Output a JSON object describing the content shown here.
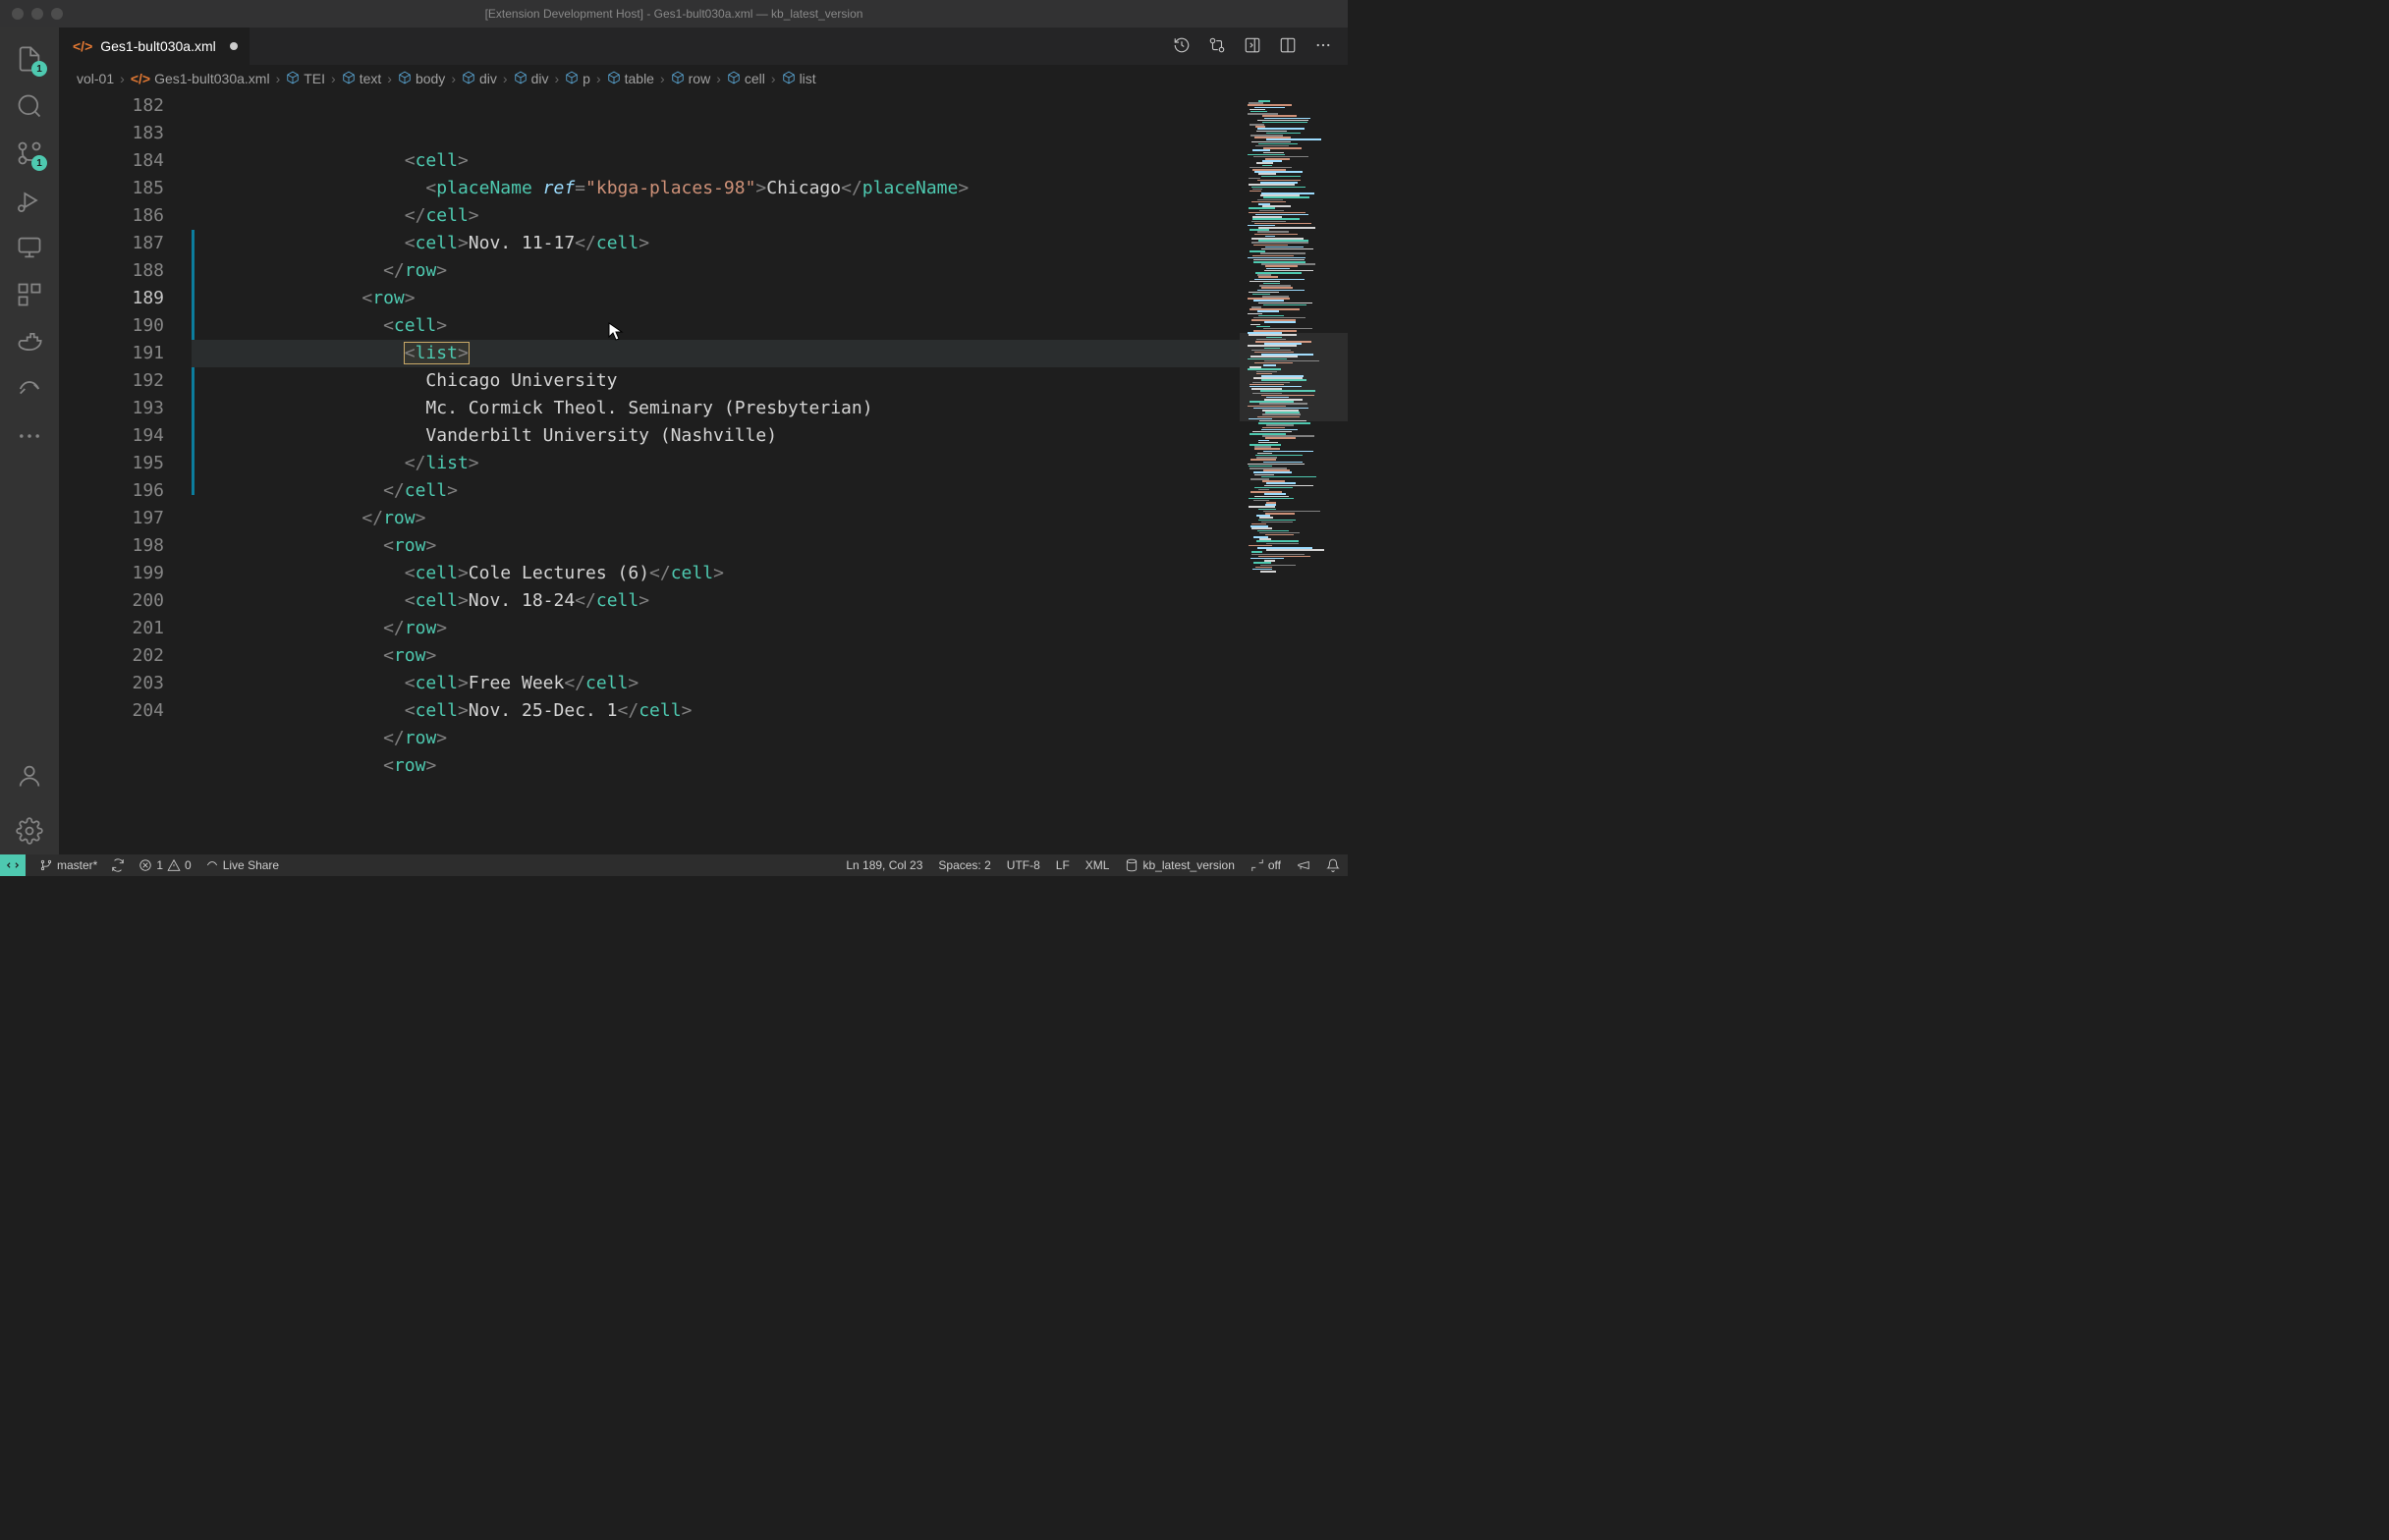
{
  "window": {
    "title": "[Extension Development Host] - Ges1-bult030a.xml — kb_latest_version"
  },
  "activitybar": {
    "explorer_badge": "1",
    "scm_badge": "1"
  },
  "tab": {
    "icon": "</>",
    "label": "Ges1-bult030a.xml"
  },
  "breadcrumbs": [
    {
      "label": "vol-01",
      "icon": ""
    },
    {
      "label": "Ges1-bult030a.xml",
      "icon": "orange"
    },
    {
      "label": "TEI",
      "icon": "cube"
    },
    {
      "label": "text",
      "icon": "cube"
    },
    {
      "label": "body",
      "icon": "cube"
    },
    {
      "label": "div",
      "icon": "cube"
    },
    {
      "label": "div",
      "icon": "cube"
    },
    {
      "label": "p",
      "icon": "cube"
    },
    {
      "label": "table",
      "icon": "cube"
    },
    {
      "label": "row",
      "icon": "cube"
    },
    {
      "label": "cell",
      "icon": "cube"
    },
    {
      "label": "list",
      "icon": "cube"
    }
  ],
  "code": {
    "start": 182,
    "current": 189,
    "lines": [
      {
        "indent": 20,
        "tokens": [
          [
            "tag",
            "<"
          ],
          [
            "tagname",
            "cell"
          ],
          [
            "tag",
            ">"
          ]
        ]
      },
      {
        "indent": 22,
        "tokens": [
          [
            "tag",
            "<"
          ],
          [
            "tagname",
            "placeName"
          ],
          [
            "text",
            " "
          ],
          [
            "attr",
            "ref"
          ],
          [
            "tag",
            "="
          ],
          [
            "string",
            "\"kbga-places-98\""
          ],
          [
            "tag",
            ">"
          ],
          [
            "text",
            "Chicago"
          ],
          [
            "tag",
            "</"
          ],
          [
            "tagname",
            "placeName"
          ],
          [
            "tag",
            ">"
          ]
        ]
      },
      {
        "indent": 20,
        "tokens": [
          [
            "tag",
            "</"
          ],
          [
            "tagname",
            "cell"
          ],
          [
            "tag",
            ">"
          ]
        ]
      },
      {
        "indent": 20,
        "tokens": [
          [
            "tag",
            "<"
          ],
          [
            "tagname",
            "cell"
          ],
          [
            "tag",
            ">"
          ],
          [
            "text",
            "Nov. 11-17"
          ],
          [
            "tag",
            "</"
          ],
          [
            "tagname",
            "cell"
          ],
          [
            "tag",
            ">"
          ]
        ]
      },
      {
        "indent": 18,
        "tokens": [
          [
            "tag",
            "</"
          ],
          [
            "tagname",
            "row"
          ],
          [
            "tag",
            ">"
          ]
        ]
      },
      {
        "indent": 16,
        "tokens": [
          [
            "tag",
            "<"
          ],
          [
            "tagname",
            "row"
          ],
          [
            "tag",
            ">"
          ]
        ]
      },
      {
        "indent": 18,
        "tokens": [
          [
            "tag",
            "<"
          ],
          [
            "tagname",
            "cell"
          ],
          [
            "tag",
            ">"
          ]
        ]
      },
      {
        "indent": 20,
        "tokens": [
          [
            "tag",
            "<"
          ],
          [
            "tagname",
            "list"
          ],
          [
            "tag",
            ">"
          ]
        ],
        "highlight": true
      },
      {
        "indent": 22,
        "tokens": [
          [
            "text",
            "Chicago University"
          ]
        ]
      },
      {
        "indent": 22,
        "tokens": [
          [
            "text",
            "Mc. Cormick Theol. Seminary (Presbyterian)"
          ]
        ]
      },
      {
        "indent": 22,
        "tokens": [
          [
            "text",
            "Vanderbilt University (Nashville)"
          ]
        ]
      },
      {
        "indent": 20,
        "tokens": [
          [
            "tag",
            "</"
          ],
          [
            "tagname",
            "list"
          ],
          [
            "tag",
            ">"
          ]
        ]
      },
      {
        "indent": 18,
        "tokens": [
          [
            "tag",
            "</"
          ],
          [
            "tagname",
            "cell"
          ],
          [
            "tag",
            ">"
          ]
        ]
      },
      {
        "indent": 16,
        "tokens": [
          [
            "tag",
            "</"
          ],
          [
            "tagname",
            "row"
          ],
          [
            "tag",
            ">"
          ]
        ]
      },
      {
        "indent": 18,
        "tokens": [
          [
            "tag",
            "<"
          ],
          [
            "tagname",
            "row"
          ],
          [
            "tag",
            ">"
          ]
        ]
      },
      {
        "indent": 20,
        "tokens": [
          [
            "tag",
            "<"
          ],
          [
            "tagname",
            "cell"
          ],
          [
            "tag",
            ">"
          ],
          [
            "text",
            "Cole Lectures (6)"
          ],
          [
            "tag",
            "</"
          ],
          [
            "tagname",
            "cell"
          ],
          [
            "tag",
            ">"
          ]
        ]
      },
      {
        "indent": 20,
        "tokens": [
          [
            "tag",
            "<"
          ],
          [
            "tagname",
            "cell"
          ],
          [
            "tag",
            ">"
          ],
          [
            "text",
            "Nov. 18-24"
          ],
          [
            "tag",
            "</"
          ],
          [
            "tagname",
            "cell"
          ],
          [
            "tag",
            ">"
          ]
        ]
      },
      {
        "indent": 18,
        "tokens": [
          [
            "tag",
            "</"
          ],
          [
            "tagname",
            "row"
          ],
          [
            "tag",
            ">"
          ]
        ]
      },
      {
        "indent": 18,
        "tokens": [
          [
            "tag",
            "<"
          ],
          [
            "tagname",
            "row"
          ],
          [
            "tag",
            ">"
          ]
        ]
      },
      {
        "indent": 20,
        "tokens": [
          [
            "tag",
            "<"
          ],
          [
            "tagname",
            "cell"
          ],
          [
            "tag",
            ">"
          ],
          [
            "text",
            "Free Week"
          ],
          [
            "tag",
            "</"
          ],
          [
            "tagname",
            "cell"
          ],
          [
            "tag",
            ">"
          ]
        ]
      },
      {
        "indent": 20,
        "tokens": [
          [
            "tag",
            "<"
          ],
          [
            "tagname",
            "cell"
          ],
          [
            "tag",
            ">"
          ],
          [
            "text",
            "Nov. 25-Dec. 1"
          ],
          [
            "tag",
            "</"
          ],
          [
            "tagname",
            "cell"
          ],
          [
            "tag",
            ">"
          ]
        ]
      },
      {
        "indent": 18,
        "tokens": [
          [
            "tag",
            "</"
          ],
          [
            "tagname",
            "row"
          ],
          [
            "tag",
            ">"
          ]
        ]
      },
      {
        "indent": 18,
        "tokens": [
          [
            "tag",
            "<"
          ],
          [
            "tagname",
            "row"
          ],
          [
            "tag",
            ">"
          ]
        ]
      }
    ]
  },
  "status": {
    "branch": "master*",
    "errors": "1",
    "warnings": "0",
    "liveshare": "Live Share",
    "cursor": "Ln 189, Col 23",
    "spaces": "Spaces: 2",
    "encoding": "UTF-8",
    "eol": "LF",
    "lang": "XML",
    "workspace": "kb_latest_version",
    "sync": "off"
  }
}
